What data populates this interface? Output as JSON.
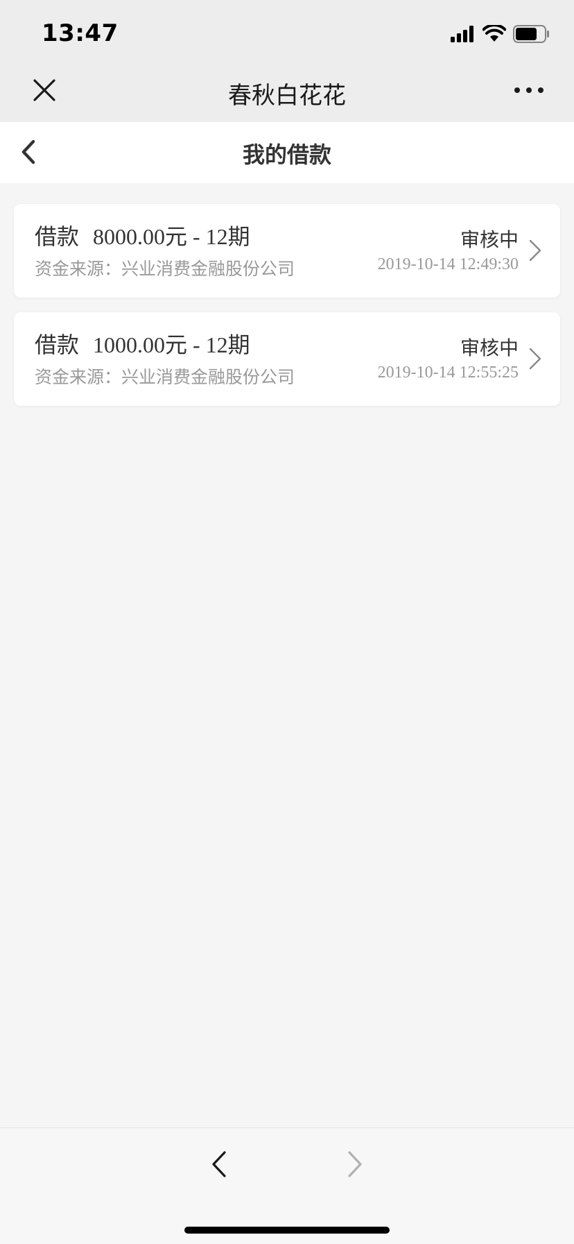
{
  "status_bar": {
    "time": "13:47",
    "icons": [
      "signal-icon",
      "wifi-icon",
      "battery-icon"
    ]
  },
  "top_nav": {
    "title": "春秋白花花",
    "left_icon": "close-icon",
    "right_icon": "more-icon"
  },
  "page_header": {
    "title": "我的借款",
    "left_icon": "back-icon"
  },
  "loans": [
    {
      "label": "借款",
      "amount": "8000.00元 - 12期",
      "source": "资金来源：兴业消费金融股份公司",
      "status": "审核中",
      "time": "2019-10-14 12:49:30"
    },
    {
      "label": "借款",
      "amount": "1000.00元 - 12期",
      "source": "资金来源：兴业消费金融股份公司",
      "status": "审核中",
      "time": "2019-10-14 12:55:25"
    }
  ],
  "bottom_bar": {
    "back_icon": "nav-back-icon",
    "forward_icon": "nav-forward-icon"
  },
  "colors": {
    "nav_background": "#ededed",
    "page_background": "#f5f5f5",
    "card_background": "#ffffff",
    "primary_text": "#333333",
    "secondary_text": "#999999"
  }
}
